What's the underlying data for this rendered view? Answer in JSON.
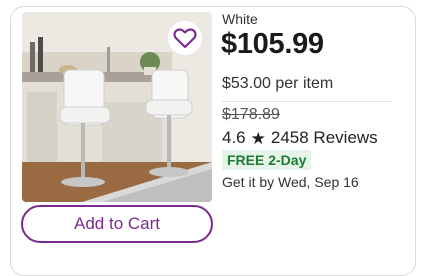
{
  "product": {
    "image_alt": "White swivel bar stools at kitchen island",
    "favorite_icon": "heart-icon",
    "color": "White",
    "price": "$105.99",
    "unit_price": "$53.00 per item",
    "was_price": "$178.89",
    "rating": "4.6",
    "rating_icon": "star-icon",
    "reviews": "2458 Reviews",
    "shipping_badge": "FREE 2-Day",
    "delivery": "Get it by Wed, Sep 16"
  },
  "actions": {
    "add_to_cart_label": "Add to Cart"
  },
  "colors": {
    "brand_purple": "#7b2b8f",
    "badge_bg": "#e6f3e8",
    "badge_text": "#1e7b34"
  }
}
